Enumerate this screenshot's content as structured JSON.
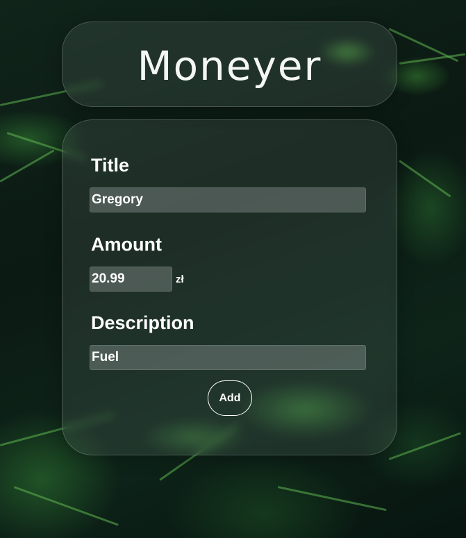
{
  "app": {
    "title": "Moneyer"
  },
  "form": {
    "title_label": "Title",
    "title_value": "Gregory",
    "amount_label": "Amount",
    "amount_value": "20.99",
    "currency": "zł",
    "description_label": "Description",
    "description_value": "Fuel",
    "add_button_label": "Add"
  },
  "colors": {
    "text": "#ffffff",
    "card_background": "rgba(130,150,140,0.16)",
    "input_background": "rgba(140,150,148,0.42)",
    "page_background": "#0d1f17"
  }
}
